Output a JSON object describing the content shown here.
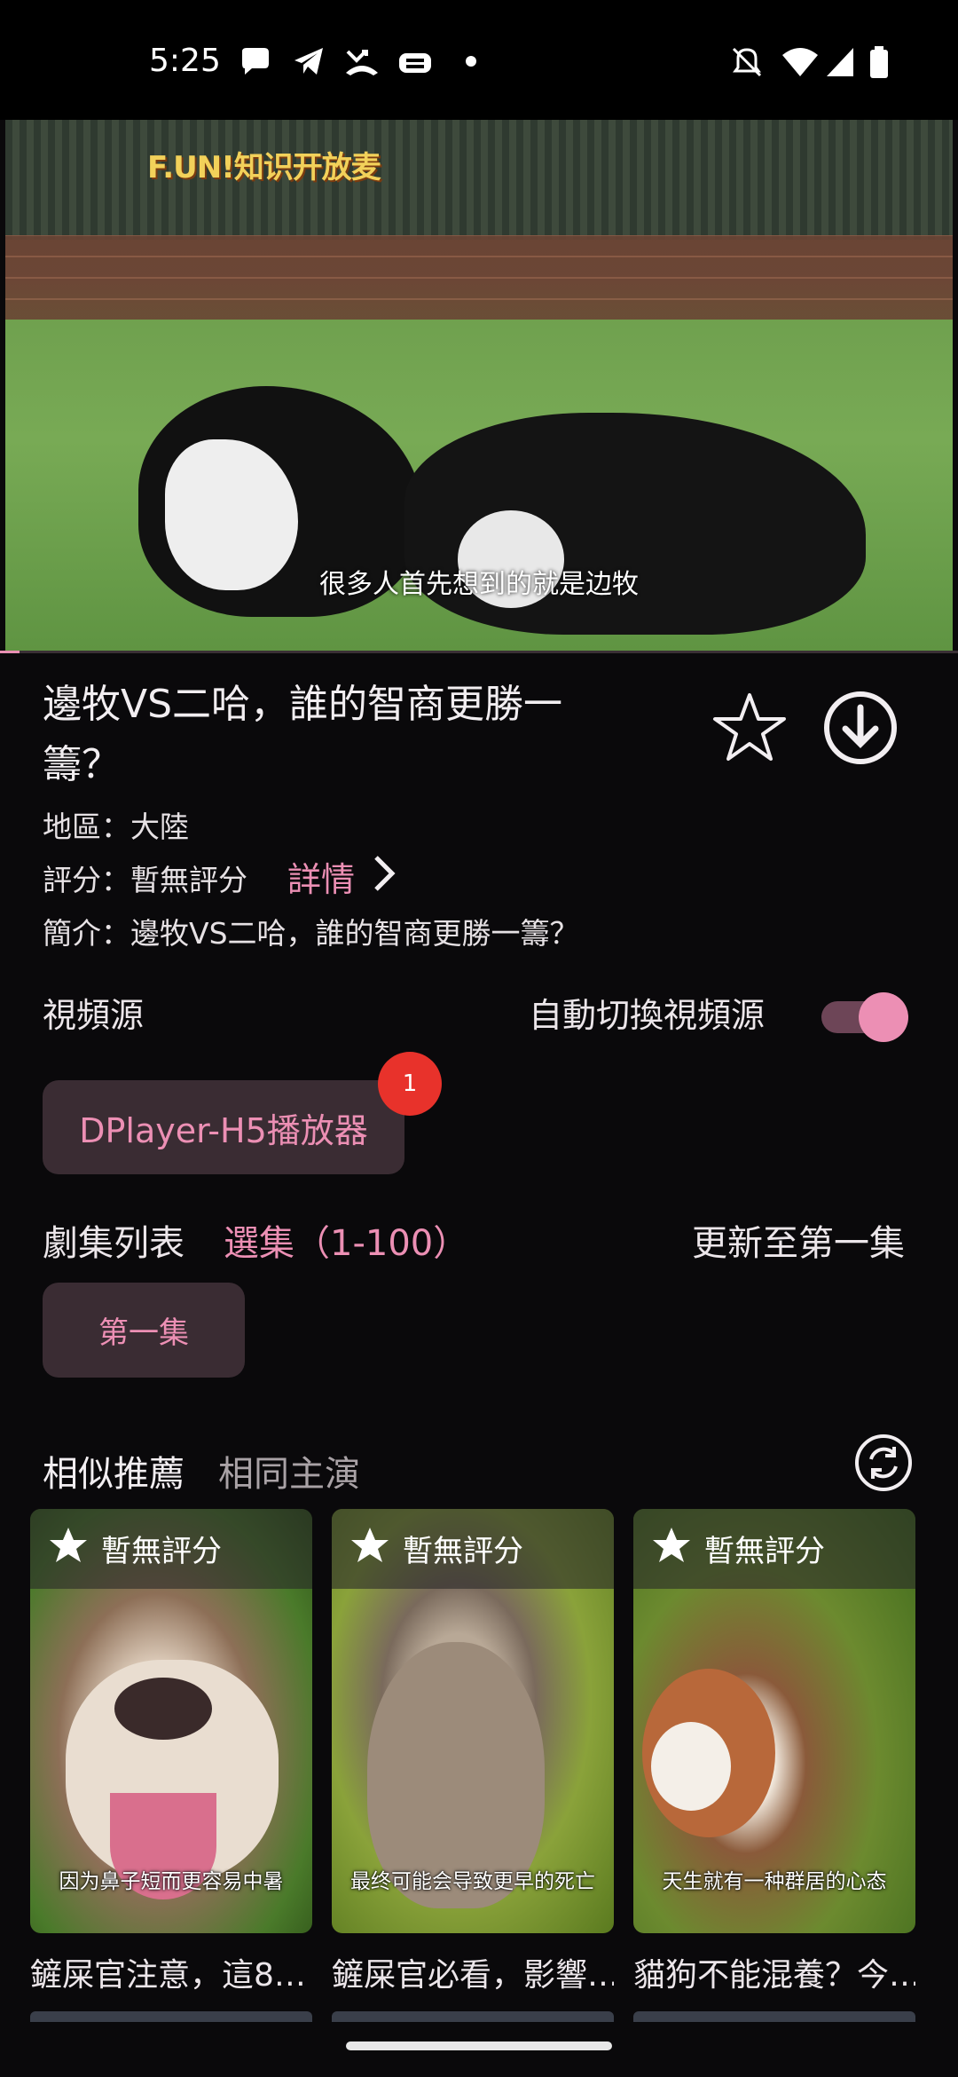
{
  "status_bar": {
    "time": "5:25",
    "icons": [
      "chat-bubble-icon",
      "telegram-icon",
      "missed-call-icon",
      "printer-icon",
      "dot-icon",
      "mute-icon",
      "wifi-icon",
      "signal-icon",
      "battery-icon"
    ]
  },
  "video": {
    "logo": "F.UN!知识开放麦",
    "subtitle": "很多人首先想到的就是边牧",
    "progress": 0.02
  },
  "info": {
    "title": "邊牧VS二哈，誰的智商更勝一籌？",
    "region": "地區：大陸",
    "rating": "評分：暫無評分",
    "detail": "詳情",
    "intro": "簡介：邊牧VS二哈，誰的智商更勝一籌？"
  },
  "source": {
    "label": "視頻源",
    "auto_switch": "自動切換視頻源",
    "auto_switch_on": true,
    "player": "DPlayer-H5播放器",
    "badge": "1"
  },
  "episodes": {
    "label": "劇集列表",
    "select": "選集（1-100）",
    "update": "更新至第一集",
    "items": [
      "第一集"
    ]
  },
  "recommend": {
    "tabs": [
      "相似推薦",
      "相同主演"
    ],
    "cards": [
      {
        "rating": "暫無評分",
        "caption": "因为鼻子短而更容易中暑",
        "title": "鏟屎官注意，這8…"
      },
      {
        "rating": "暫無評分",
        "caption": "最终可能会导致更早的死亡",
        "title": "鏟屎官必看，影響…"
      },
      {
        "rating": "暫無評分",
        "caption": "天生就有一种群居的心态",
        "title": "貓狗不能混養？今…"
      }
    ]
  },
  "colors": {
    "accent": "#ec8fb4",
    "badge": "#e8322b",
    "background": "#0a090b"
  }
}
